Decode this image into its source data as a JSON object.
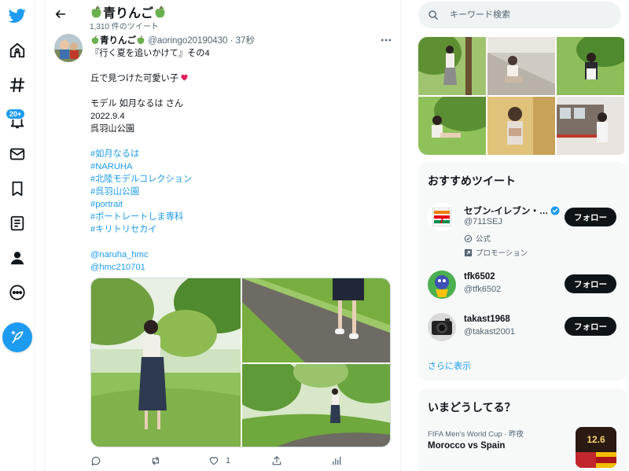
{
  "colors": {
    "accent": "#1d9bf0",
    "text": "#0f1419",
    "muted": "#536471",
    "card_bg": "#f7f9f9"
  },
  "nav": {
    "items": [
      {
        "id": "logo",
        "icon": "twitter-bird-icon"
      },
      {
        "id": "home",
        "icon": "home-icon"
      },
      {
        "id": "explore",
        "icon": "hashtag-icon"
      },
      {
        "id": "notifications",
        "icon": "bell-icon",
        "badge": "20+"
      },
      {
        "id": "messages",
        "icon": "envelope-icon"
      },
      {
        "id": "bookmarks",
        "icon": "bookmark-icon"
      },
      {
        "id": "lists",
        "icon": "list-icon"
      },
      {
        "id": "profile",
        "icon": "person-icon"
      },
      {
        "id": "more",
        "icon": "more-circle-icon"
      }
    ],
    "compose_icon": "feather-icon"
  },
  "header": {
    "title": "青りんご",
    "subtitle": "1,310 件のツイート"
  },
  "tweet": {
    "name": "青りんご",
    "handle": "@aoringo20190430",
    "dot": "·",
    "time": "37秒",
    "lines": [
      {
        "text": "『行く夏を追いかけて』その4",
        "type": "text"
      },
      {
        "text": "",
        "type": "blank"
      },
      {
        "text": "丘で見つけた可愛い子",
        "type": "text",
        "heart": true
      },
      {
        "text": "",
        "type": "blank"
      },
      {
        "text": "モデル 如月なるは さん",
        "type": "text"
      },
      {
        "text": "2022.9.4",
        "type": "text"
      },
      {
        "text": "呉羽山公園",
        "type": "text"
      },
      {
        "text": "",
        "type": "blank"
      },
      {
        "text": "#如月なるは",
        "type": "tag"
      },
      {
        "text": "#NARUHA",
        "type": "tag"
      },
      {
        "text": "#北陸モデルコレクション",
        "type": "tag"
      },
      {
        "text": "#呉羽山公園",
        "type": "tag"
      },
      {
        "text": "#portrait",
        "type": "tag"
      },
      {
        "text": "#ポートレートしま専科",
        "type": "tag"
      },
      {
        "text": "#キリトリセカイ",
        "type": "tag"
      },
      {
        "text": "",
        "type": "blank"
      },
      {
        "text": "@naruha_hmc",
        "type": "tag"
      },
      {
        "text": "@hmc210701",
        "type": "tag"
      }
    ],
    "actions": {
      "reply": "",
      "retweet": "",
      "like": "1",
      "share": "",
      "analytics": ""
    }
  },
  "search": {
    "placeholder": "キーワード検索"
  },
  "recommended": {
    "title": "おすすめツイート",
    "accounts": [
      {
        "name": "セブン-イレブン・…",
        "handle": "@711SEJ",
        "verified": true,
        "label": "公式",
        "promo": "プロモーション",
        "button": "フォロー"
      },
      {
        "name": "tfk6502",
        "handle": "@tfk6502",
        "button": "フォロー"
      },
      {
        "name": "takast1968",
        "handle": "@takast2001",
        "button": "フォロー"
      }
    ],
    "show_more": "さらに表示"
  },
  "trends": {
    "title": "いまどうしてる？",
    "item": {
      "meta": "FIFA Men's World Cup · 昨夜",
      "title": "Morocco vs Spain",
      "thumb_text": "12.6"
    }
  }
}
